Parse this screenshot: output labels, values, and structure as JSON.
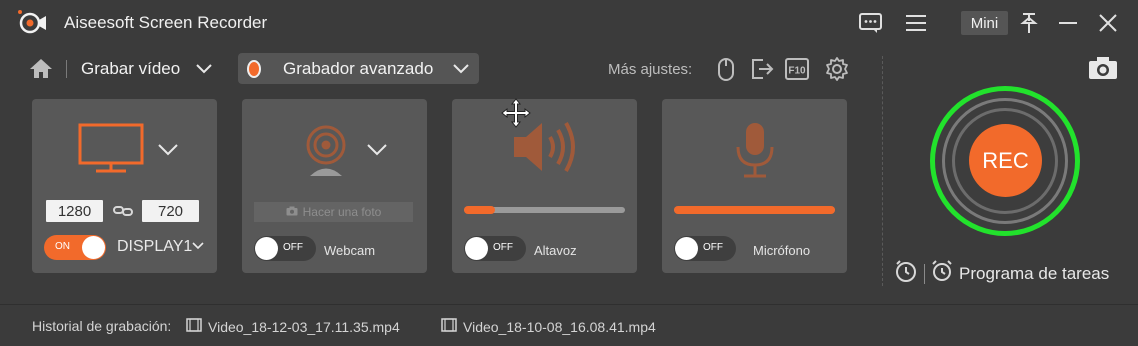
{
  "app": {
    "title": "Aiseesoft Screen Recorder"
  },
  "titlebar": {
    "mini_label": "Mini",
    "icons": [
      "feedback-icon",
      "menu-icon",
      "pin-icon",
      "minimize-icon",
      "close-icon"
    ]
  },
  "toolbar": {
    "mode_label": "Grabar vídeo",
    "advanced_label": "Grabador avanzado",
    "more_settings_label": "Más ajustes:",
    "settings_icons": [
      "mouse-icon",
      "export-icon",
      "f10-hotkey-icon",
      "gear-icon"
    ]
  },
  "cards": {
    "display": {
      "width": "1280",
      "height": "720",
      "toggle": "ON",
      "source": "DISPLAY1"
    },
    "webcam": {
      "photo_label": "Hacer una foto",
      "toggle": "OFF",
      "label": "Webcam"
    },
    "speaker": {
      "toggle": "OFF",
      "label": "Altavoz",
      "volume": 0.19
    },
    "microphone": {
      "toggle": "OFF",
      "label": "Micrófono",
      "volume": 1.0
    }
  },
  "recorder": {
    "rec_label": "REC",
    "schedule_label": "Programa de tareas"
  },
  "history": {
    "label": "Historial de grabación:",
    "files": [
      "Video_18-12-03_17.11.35.mp4",
      "Video_18-10-08_16.08.41.mp4"
    ]
  },
  "colors": {
    "accent": "#f26a2b",
    "rec_ring": "#22e22c",
    "background": "#3b3b3b",
    "card": "#585858"
  }
}
